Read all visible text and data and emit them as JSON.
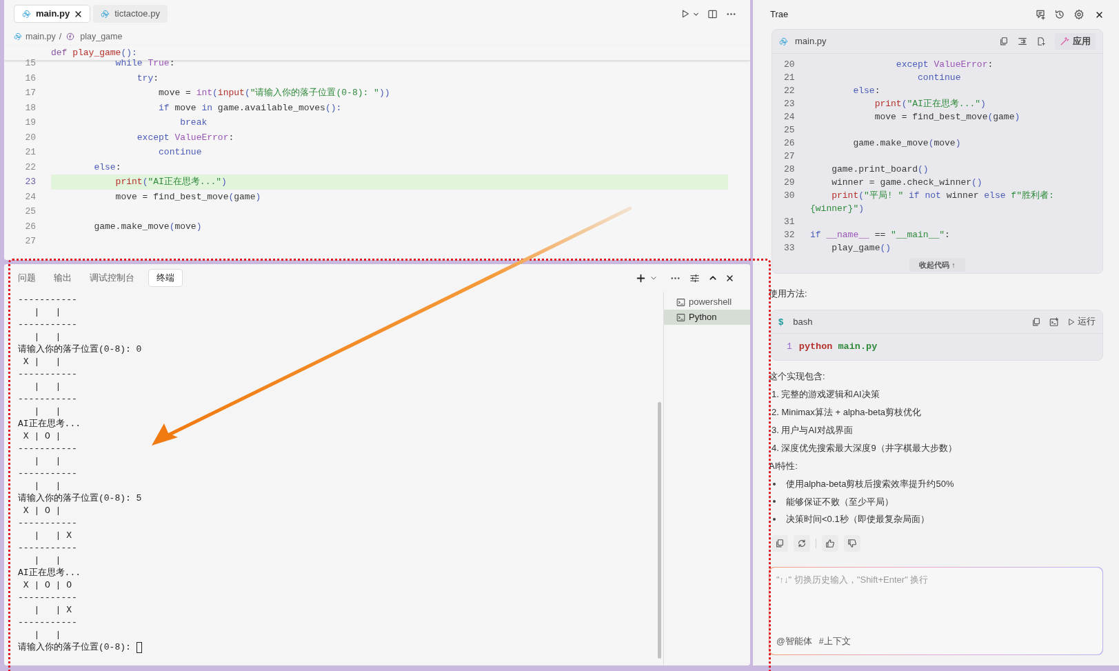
{
  "editor": {
    "tabs": [
      {
        "label": "main.py",
        "selected": true,
        "closable": true
      },
      {
        "label": "tictactoe.py",
        "selected": false,
        "closable": false
      }
    ],
    "breadcrumb": {
      "file": "main.py",
      "separator": "/",
      "symbol": "play_game"
    },
    "sticky_line": [
      {
        "text": "def",
        "kind": "def"
      },
      {
        "text": " play_game",
        "kind": "function"
      },
      {
        "text": "():",
        "kind": "bracket"
      }
    ],
    "lines": [
      {
        "number": "15",
        "highlighted": false,
        "tokens": [
          {
            "text": "            while",
            "kind": "keyword"
          },
          {
            "text": " True",
            "kind": "class"
          },
          {
            "text": ":",
            "kind": "plain"
          }
        ]
      },
      {
        "number": "16",
        "highlighted": false,
        "tokens": [
          {
            "text": "                try",
            "kind": "keyword"
          },
          {
            "text": ":",
            "kind": "plain"
          }
        ]
      },
      {
        "number": "17",
        "highlighted": false,
        "tokens": [
          {
            "text": "                    move = ",
            "kind": "plain"
          },
          {
            "text": "int",
            "kind": "class"
          },
          {
            "text": "(",
            "kind": "bracket"
          },
          {
            "text": "input",
            "kind": "function"
          },
          {
            "text": "(",
            "kind": "bracket"
          },
          {
            "text": "\"请输入你的落子位置(0-8): \"",
            "kind": "string"
          },
          {
            "text": "))",
            "kind": "bracket"
          }
        ]
      },
      {
        "number": "18",
        "highlighted": false,
        "tokens": [
          {
            "text": "                    if",
            "kind": "keyword"
          },
          {
            "text": " move ",
            "kind": "plain"
          },
          {
            "text": "in",
            "kind": "keyword"
          },
          {
            "text": " game.available_moves",
            "kind": "plain"
          },
          {
            "text": "():",
            "kind": "bracket"
          }
        ]
      },
      {
        "number": "19",
        "highlighted": false,
        "tokens": [
          {
            "text": "                        break",
            "kind": "keyword"
          }
        ]
      },
      {
        "number": "20",
        "highlighted": false,
        "tokens": [
          {
            "text": "                except",
            "kind": "keyword"
          },
          {
            "text": " ValueError",
            "kind": "class"
          },
          {
            "text": ":",
            "kind": "plain"
          }
        ]
      },
      {
        "number": "21",
        "highlighted": false,
        "tokens": [
          {
            "text": "                    continue",
            "kind": "keyword"
          }
        ]
      },
      {
        "number": "22",
        "highlighted": false,
        "tokens": [
          {
            "text": "        else",
            "kind": "keyword"
          },
          {
            "text": ":",
            "kind": "plain"
          }
        ]
      },
      {
        "number": "23",
        "highlighted": true,
        "tokens": [
          {
            "text": "            print",
            "kind": "function"
          },
          {
            "text": "(",
            "kind": "bracket"
          },
          {
            "text": "\"AI正在思考...\"",
            "kind": "string"
          },
          {
            "text": ")",
            "kind": "bracket"
          }
        ]
      },
      {
        "number": "24",
        "highlighted": false,
        "tokens": [
          {
            "text": "            move = find_best_move",
            "kind": "plain"
          },
          {
            "text": "(",
            "kind": "bracket"
          },
          {
            "text": "game",
            "kind": "plain"
          },
          {
            "text": ")",
            "kind": "bracket"
          }
        ]
      },
      {
        "number": "25",
        "highlighted": false
      },
      {
        "number": "26",
        "highlighted": false,
        "tokens": [
          {
            "text": "        game.make_move",
            "kind": "plain"
          },
          {
            "text": "(",
            "kind": "bracket"
          },
          {
            "text": "move",
            "kind": "plain"
          },
          {
            "text": ")",
            "kind": "bracket"
          }
        ]
      },
      {
        "number": "27",
        "highlighted": false
      }
    ]
  },
  "panel": {
    "tabs": [
      {
        "label": "问题",
        "selected": false
      },
      {
        "label": "输出",
        "selected": false
      },
      {
        "label": "调试控制台",
        "selected": false
      },
      {
        "label": "终端",
        "selected": true
      }
    ],
    "terminal_lines": [
      "-----------",
      "   |   |",
      "-----------",
      "   |   |",
      "请输入你的落子位置(0-8): 0",
      " X |   |",
      "-----------",
      "   |   |",
      "-----------",
      "   |   |",
      "AI正在思考...",
      " X | O |",
      "-----------",
      "   |   |",
      "-----------",
      "   |   |",
      "请输入你的落子位置(0-8): 5",
      " X | O |",
      "-----------",
      "   |   | X",
      "-----------",
      "   |   |",
      "AI正在思考...",
      " X | O | O",
      "-----------",
      "   |   | X",
      "-----------",
      "   |   |",
      "请输入你的落子位置(0-8): "
    ],
    "cursor": true,
    "sessions": [
      {
        "label": "powershell",
        "selected": false
      },
      {
        "label": "Python",
        "selected": true
      }
    ]
  },
  "assistant": {
    "title": "Trae",
    "code_card": {
      "file": "main.py",
      "apply_label": "应用",
      "collapse_label": "收起代码 ↑",
      "lines": [
        {
          "number": "20",
          "tokens": [
            {
              "text": "                except",
              "kind": "keyword"
            },
            {
              "text": " ValueError",
              "kind": "class"
            },
            {
              "text": ":",
              "kind": "plain"
            }
          ]
        },
        {
          "number": "21",
          "tokens": [
            {
              "text": "                    continue",
              "kind": "keyword"
            }
          ]
        },
        {
          "number": "22",
          "tokens": [
            {
              "text": "        else",
              "kind": "keyword"
            },
            {
              "text": ":",
              "kind": "plain"
            }
          ]
        },
        {
          "number": "23",
          "tokens": [
            {
              "text": "            print",
              "kind": "function"
            },
            {
              "text": "(",
              "kind": "bracket"
            },
            {
              "text": "\"AI正在思考...\"",
              "kind": "string"
            },
            {
              "text": ")",
              "kind": "bracket"
            }
          ]
        },
        {
          "number": "24",
          "tokens": [
            {
              "text": "            move = find_best_move",
              "kind": "plain"
            },
            {
              "text": "(",
              "kind": "bracket"
            },
            {
              "text": "game",
              "kind": "plain"
            },
            {
              "text": ")",
              "kind": "bracket"
            }
          ]
        },
        {
          "number": "25"
        },
        {
          "number": "26",
          "tokens": [
            {
              "text": "        game.make_move",
              "kind": "plain"
            },
            {
              "text": "(",
              "kind": "bracket"
            },
            {
              "text": "move",
              "kind": "plain"
            },
            {
              "text": ")",
              "kind": "bracket"
            }
          ]
        },
        {
          "number": "27"
        },
        {
          "number": "28",
          "tokens": [
            {
              "text": "    game.print_board",
              "kind": "plain"
            },
            {
              "text": "()",
              "kind": "bracket"
            }
          ]
        },
        {
          "number": "29",
          "tokens": [
            {
              "text": "    winner = game.check_winner",
              "kind": "plain"
            },
            {
              "text": "()",
              "kind": "bracket"
            }
          ]
        },
        {
          "number": "30",
          "tokens": [
            {
              "text": "    print",
              "kind": "function"
            },
            {
              "text": "(",
              "kind": "bracket"
            },
            {
              "text": "\"平局! \"",
              "kind": "string"
            },
            {
              "text": " if",
              "kind": "keyword"
            },
            {
              "text": " not",
              "kind": "keyword"
            },
            {
              "text": " winner ",
              "kind": "plain"
            },
            {
              "text": "else",
              "kind": "keyword"
            },
            {
              "text": " f\"胜利者: {winner}\"",
              "kind": "string"
            },
            {
              "text": ")",
              "kind": "bracket"
            }
          ]
        },
        {
          "number": "31"
        },
        {
          "number": "32",
          "tokens": [
            {
              "text": "if",
              "kind": "keyword"
            },
            {
              "text": " __name__",
              "kind": "class"
            },
            {
              "text": " == ",
              "kind": "plain"
            },
            {
              "text": "\"__main__\"",
              "kind": "string"
            },
            {
              "text": ":",
              "kind": "plain"
            }
          ]
        },
        {
          "number": "33",
          "tokens": [
            {
              "text": "    play_game",
              "kind": "plain"
            },
            {
              "text": "()",
              "kind": "bracket"
            }
          ]
        }
      ]
    },
    "sections": [
      {
        "kind": "paragraph",
        "text": "使用方法:"
      },
      {
        "kind": "command",
        "prompt": "$",
        "language": "bash",
        "run_label": "运行",
        "lines": [
          {
            "number": "1",
            "tokens": [
              {
                "text": "python",
                "kind": "function"
              },
              {
                "text": " main.py",
                "kind": "string"
              }
            ]
          }
        ]
      },
      {
        "kind": "paragraph",
        "text": "这个实现包含:"
      },
      {
        "kind": "numbered",
        "text": "1. 完整的游戏逻辑和AI决策"
      },
      {
        "kind": "numbered",
        "text": "2. Minimax算法 + alpha-beta剪枝优化"
      },
      {
        "kind": "numbered",
        "text": "3. 用户与AI对战界面"
      },
      {
        "kind": "numbered",
        "text": "4. 深度优先搜索最大深度9（井字棋最大步数）"
      },
      {
        "kind": "paragraph",
        "text": "AI特性:"
      },
      {
        "kind": "bullet",
        "text": "使用alpha-beta剪枝后搜索效率提升约50%"
      },
      {
        "kind": "bullet",
        "text": "能够保证不败（至少平局）"
      },
      {
        "kind": "bullet",
        "text": "决策时间<0.1秒（即使最复杂局面）"
      }
    ],
    "input": {
      "placeholder": "\"↑↓\" 切换历史输入，\"Shift+Enter\" 换行",
      "mentions": [
        "@智能体",
        "#上下文"
      ]
    }
  }
}
